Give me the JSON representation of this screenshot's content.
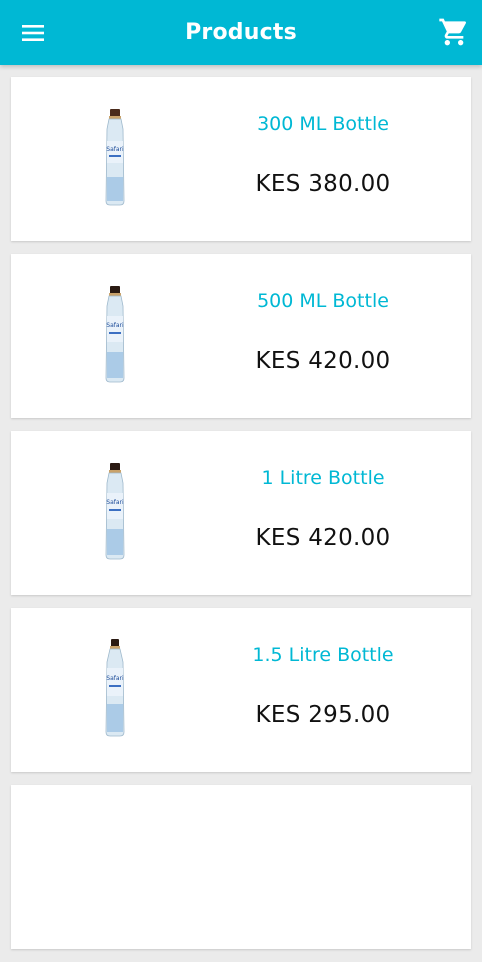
{
  "appbar": {
    "title": "Products",
    "menu_icon": "menu-icon",
    "cart_icon": "shopping-cart-icon",
    "background_color": "#00b8d4"
  },
  "products": [
    {
      "name": "300 ML Bottle",
      "price": "KES 380.00"
    },
    {
      "name": "500 ML Bottle",
      "price": "KES 420.00"
    },
    {
      "name": "1 Litre Bottle",
      "price": "KES 420.00"
    },
    {
      "name": "1.5 Litre Bottle",
      "price": "KES 295.00"
    }
  ],
  "colors": {
    "accent": "#00b8d4",
    "price_text": "#111111",
    "page_background": "#ebebeb"
  }
}
